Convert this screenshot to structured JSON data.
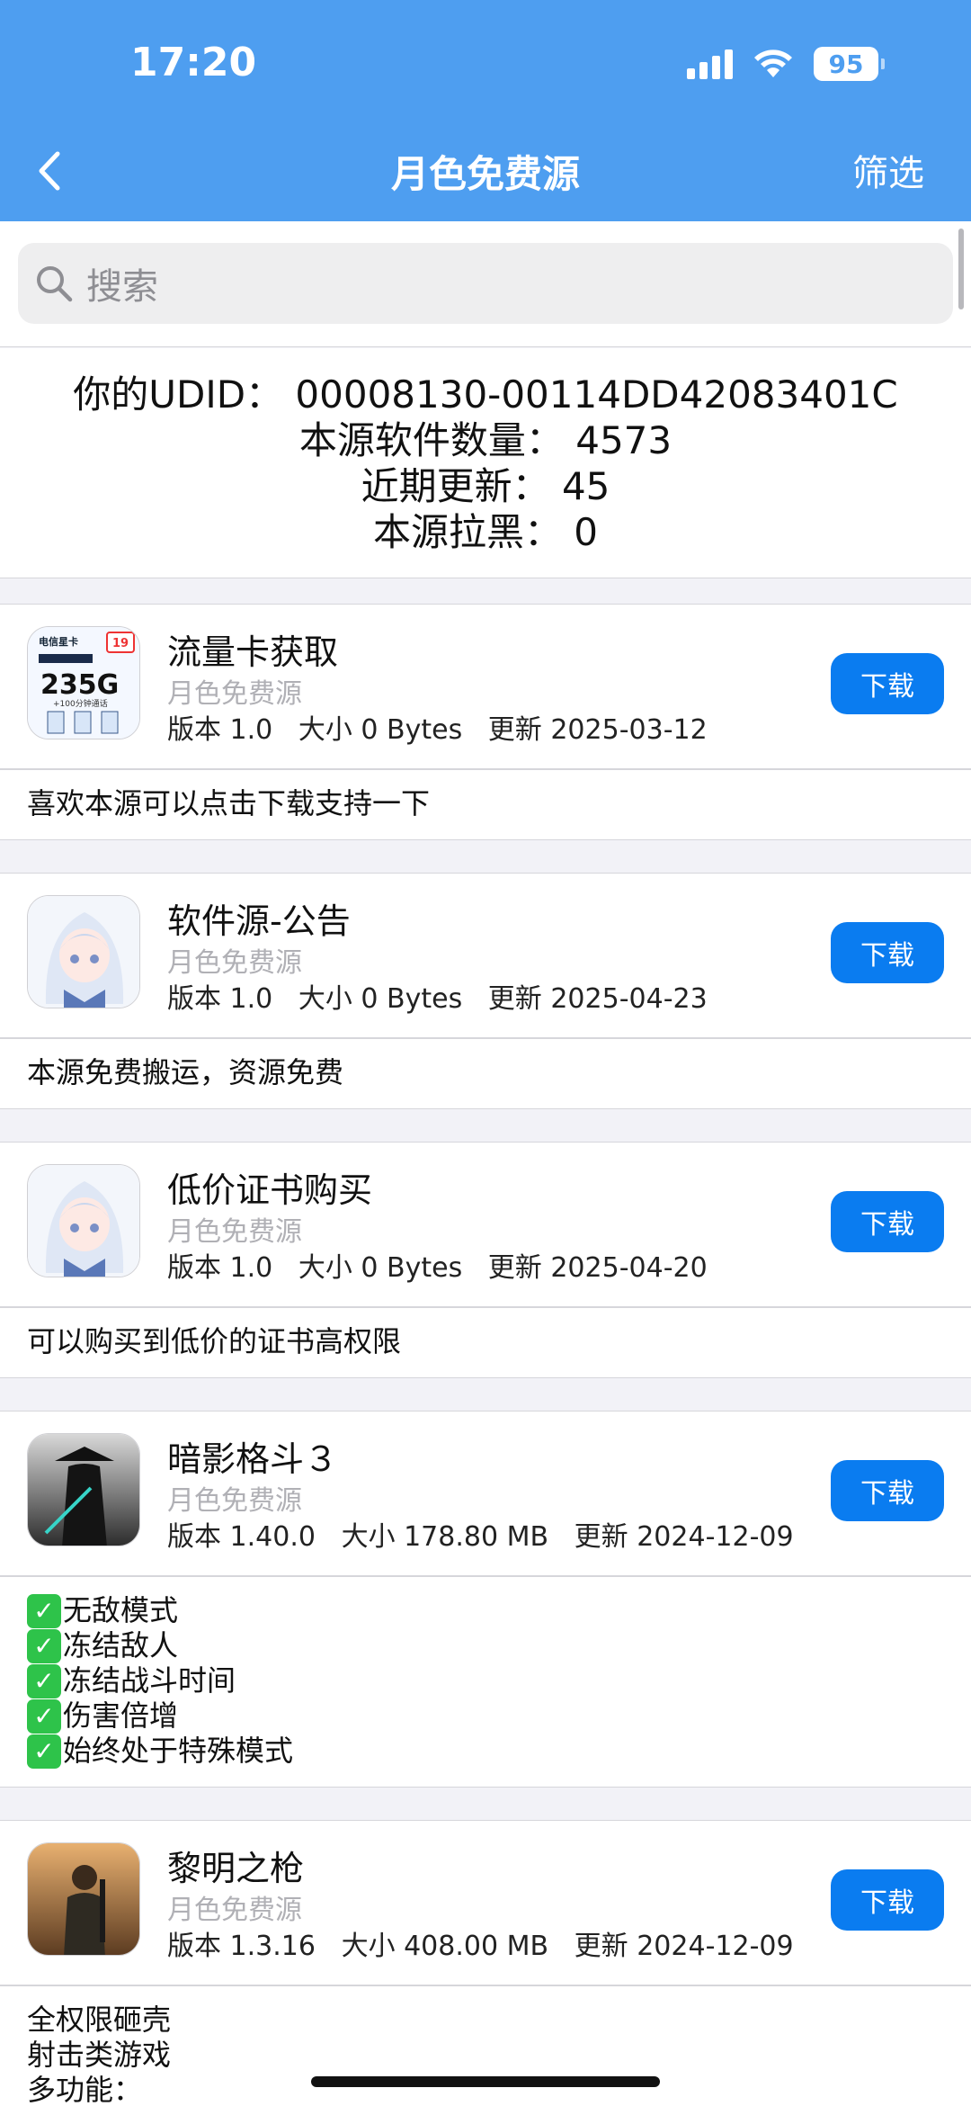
{
  "status": {
    "time": "17:20",
    "battery": "95"
  },
  "nav": {
    "title": "月色免费源",
    "filter": "筛选"
  },
  "search": {
    "placeholder": "搜索"
  },
  "info": {
    "udid": "你的UDID：  00008130-00114DD42083401C",
    "count": "本源软件数量：  4573",
    "recent": "近期更新：  45",
    "blacklist": "本源拉黑：  0"
  },
  "apps": [
    {
      "name": "流量卡获取",
      "source": "月色免费源",
      "meta": "版本 1.0   大小 0 Bytes   更新 2025-03-12",
      "button": "下载",
      "icon": {
        "top": "电信星卡",
        "badge": "19",
        "big": "235G",
        "sub": "+100分钟通话"
      },
      "desc": [
        "喜欢本源可以点击下载支持一下"
      ]
    },
    {
      "name": "软件源-公告",
      "source": "月色免费源",
      "meta": "版本 1.0   大小 0 Bytes   更新 2025-04-23",
      "button": "下载",
      "desc": [
        "本源免费搬运，资源免费"
      ]
    },
    {
      "name": "低价证书购买",
      "source": "月色免费源",
      "meta": "版本 1.0   大小 0 Bytes   更新 2025-04-20",
      "button": "下载",
      "desc": [
        "可以购买到低价的证书高权限"
      ]
    },
    {
      "name": "暗影格斗３",
      "source": "月色免费源",
      "meta": "版本 1.40.0   大小 178.80 MB   更新 2024-12-09",
      "button": "下载",
      "desc": [
        "无敌模式",
        "冻结敌人",
        "冻结战斗时间",
        "伤害倍增",
        "始终处于特殊模式"
      ]
    },
    {
      "name": "黎明之枪",
      "source": "月色免费源",
      "meta": "版本 1.3.16   大小 408.00 MB   更新 2024-12-09",
      "button": "下载",
      "desc": [
        "全权限砸壳",
        "射击类游戏",
        "多功能："
      ]
    }
  ],
  "colors": {
    "header": "#4e9ef0",
    "button": "#0a7cf0",
    "check": "#2ec34a"
  }
}
